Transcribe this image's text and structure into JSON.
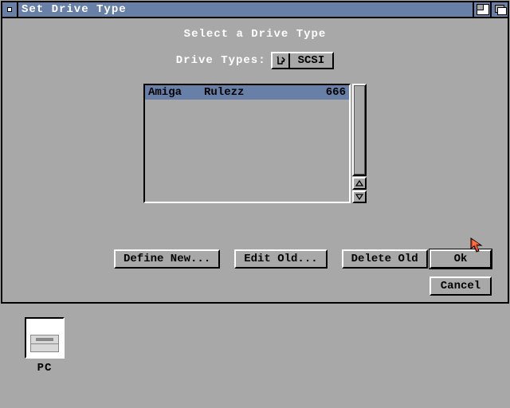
{
  "window": {
    "title": "Set Drive Type"
  },
  "dialog": {
    "heading": "Select a Drive Type",
    "types_label": "Drive Types:",
    "selected_type": "SCSI"
  },
  "list": {
    "items": [
      {
        "c1": "Amiga",
        "c2": "Rulezz",
        "c3": "666",
        "selected": true
      }
    ]
  },
  "buttons": {
    "define_new": "Define New...",
    "edit_old": "Edit Old...",
    "delete_old": "Delete Old",
    "ok": "Ok",
    "cancel": "Cancel"
  },
  "desktop": {
    "icon_label": "PC"
  }
}
